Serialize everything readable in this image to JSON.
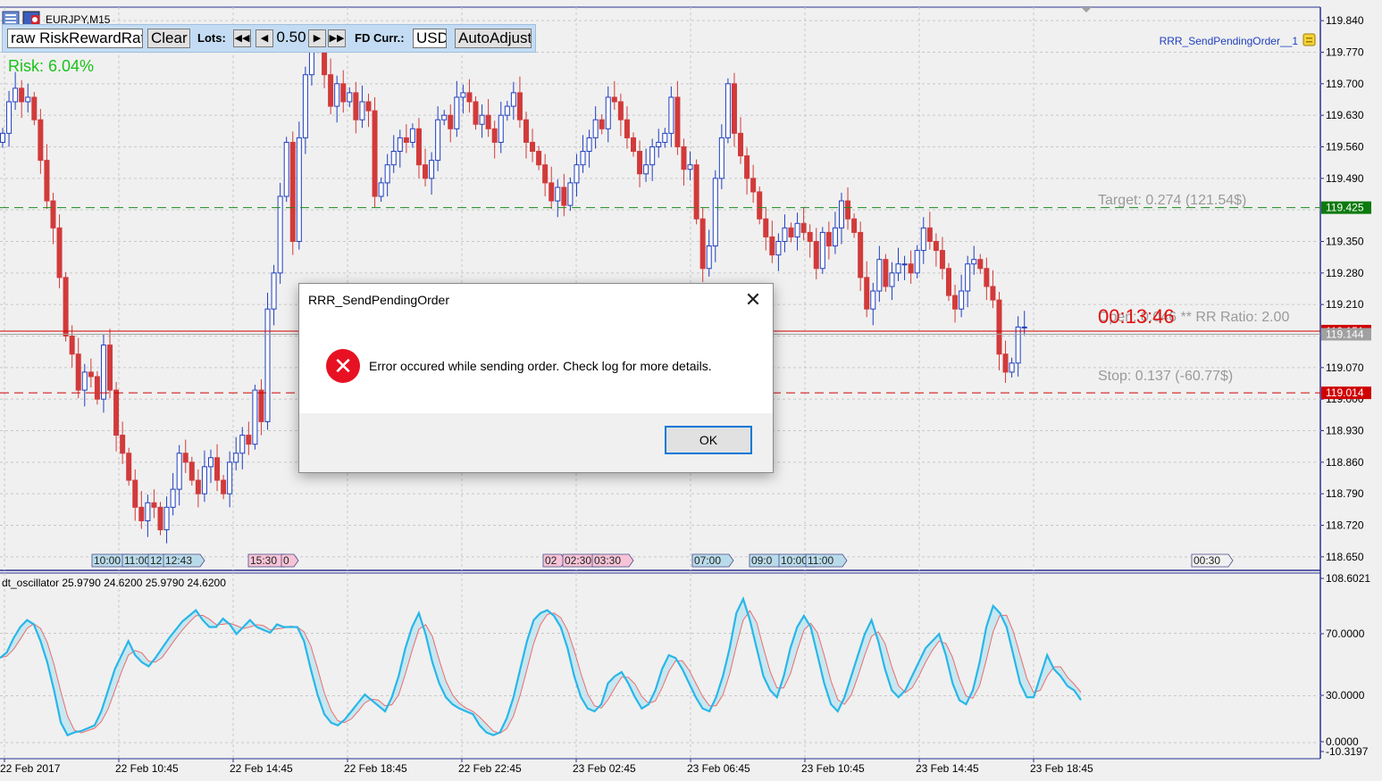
{
  "window": {
    "symbol_label": "EURJPY,M15",
    "ea_name": "RRR_SendPendingOrder__1",
    "indicator_label": "dt_oscillator 25.9790 24.6200 25.9790 24.6200"
  },
  "toolbar": {
    "draw_button": "raw RiskRewardRati",
    "clear_button": "Clear",
    "lots_label": "Lots:",
    "lots_value": "0.50",
    "curr_label": "FD Curr.:",
    "curr_value": "USD",
    "autoadjust_button": "AutoAdjust"
  },
  "risk_text": "Risk: 6.04%",
  "levels": {
    "target_text": "Target: 0.274 (121.54$)",
    "target_price": "119.425",
    "target_value": 119.425,
    "open_text": "Open: 0.046 ** RR Ratio: 2.00",
    "open_price": "119.151",
    "open_value": 119.151,
    "bid_price": "119.144",
    "bid_value": 119.144,
    "stop_text": "Stop: 0.137 (-60.77$)",
    "stop_price": "119.014",
    "stop_value": 119.014,
    "countdown": "00:13:46"
  },
  "price_axis": {
    "ticks": [
      "119.840",
      "119.770",
      "119.700",
      "119.630",
      "119.560",
      "119.490",
      "119.420",
      "119.350",
      "119.280",
      "119.210",
      "119.140",
      "119.070",
      "119.000",
      "118.930",
      "118.860",
      "118.790",
      "118.720",
      "118.650"
    ],
    "max": 119.87,
    "min": 118.62
  },
  "time_axis": [
    "22 Feb 2017",
    "22 Feb 10:45",
    "22 Feb 14:45",
    "22 Feb 18:45",
    "22 Feb 22:45",
    "23 Feb 02:45",
    "23 Feb 06:45",
    "23 Feb 10:45",
    "23 Feb 14:45",
    "23 Feb 18:45"
  ],
  "session_markers": [
    {
      "text": "10:00",
      "color": "#b9dbe9"
    },
    {
      "text": "11:00",
      "color": "#b9dbe9"
    },
    {
      "text": "12",
      "color": "#b9dbe9"
    },
    {
      "text": "12:43",
      "color": "#b9dbe9"
    },
    {
      "text": "15:30",
      "color": "#f6c4d6"
    },
    {
      "text": "0",
      "color": "#f6c4d6"
    },
    {
      "text": "02",
      "color": "#f6c4d6"
    },
    {
      "text": "02:30",
      "color": "#f6c4d6"
    },
    {
      "text": "03:30",
      "color": "#f6c4d6"
    },
    {
      "text": "07:00",
      "color": "#b9dbe9"
    },
    {
      "text": "09:0",
      "color": "#b9dbe9"
    },
    {
      "text": "10:00",
      "color": "#b9dbe9"
    },
    {
      "text": "11:00",
      "color": "#b9dbe9"
    },
    {
      "text": "00:30",
      "color": "#f0f0f0"
    }
  ],
  "oscillator_axis": {
    "ticks": [
      "108.6021",
      "70.0000",
      "30.0000",
      "0.0000",
      "-10.3197"
    ],
    "max": 108.6021,
    "min": -10.3197
  },
  "dialog": {
    "title": "RRR_SendPendingOrder",
    "close_glyph": "✕",
    "icon_glyph": "✕",
    "message": "Error occured while sending order. Check log for more details.",
    "ok_label": "OK"
  },
  "colors": {
    "bull": "#1f3fbf",
    "bear": "#d23a3a",
    "target_line": "#1a8a1a",
    "stop_line": "#d00000",
    "osc_main": "#29b6e8",
    "osc_signal": "#ef6b6b",
    "risk_text": "#19c219"
  },
  "chart_data": {
    "type": "candlestick",
    "symbol": "EURJPY",
    "timeframe": "M15",
    "close": [
      119.59,
      119.66,
      119.69,
      119.66,
      119.67,
      119.62,
      119.53,
      119.44,
      119.38,
      119.27,
      119.14,
      119.1,
      119.02,
      119.06,
      119.05,
      119.0,
      119.12,
      119.02,
      118.92,
      118.88,
      118.82,
      118.76,
      118.73,
      118.77,
      118.76,
      118.71,
      118.76,
      118.8,
      118.88,
      118.86,
      118.82,
      118.79,
      118.85,
      118.87,
      118.82,
      118.79,
      118.86,
      118.88,
      118.92,
      118.9,
      119.02,
      118.95,
      119.2,
      119.28,
      119.45,
      119.57,
      119.35,
      119.58,
      119.72,
      119.8,
      119.78,
      119.72,
      119.65,
      119.7,
      119.66,
      119.68,
      119.62,
      119.66,
      119.64,
      119.45,
      119.48,
      119.52,
      119.55,
      119.58,
      119.57,
      119.6,
      119.52,
      119.49,
      119.53,
      119.62,
      119.63,
      119.6,
      119.67,
      119.68,
      119.66,
      119.61,
      119.63,
      119.6,
      119.57,
      119.63,
      119.65,
      119.68,
      119.62,
      119.57,
      119.55,
      119.52,
      119.48,
      119.44,
      119.47,
      119.43,
      119.48,
      119.52,
      119.55,
      119.58,
      119.62,
      119.6,
      119.67,
      119.66,
      119.62,
      119.58,
      119.55,
      119.5,
      119.52,
      119.56,
      119.57,
      119.59,
      119.67,
      119.56,
      119.51,
      119.52,
      119.4,
      119.29,
      119.34,
      119.49,
      119.58,
      119.7,
      119.59,
      119.54,
      119.49,
      119.46,
      119.4,
      119.36,
      119.32,
      119.35,
      119.38,
      119.36,
      119.39,
      119.37,
      119.35,
      119.29,
      119.37,
      119.34,
      119.38,
      119.44,
      119.4,
      119.37,
      119.27,
      119.2,
      119.24,
      119.31,
      119.25,
      119.28,
      119.3,
      119.3,
      119.28,
      119.33,
      119.38,
      119.35,
      119.33,
      119.29,
      119.23,
      119.2,
      119.24,
      119.3,
      119.31,
      119.29,
      119.25,
      119.22,
      119.1,
      119.06,
      119.08,
      119.16,
      119.16
    ]
  }
}
